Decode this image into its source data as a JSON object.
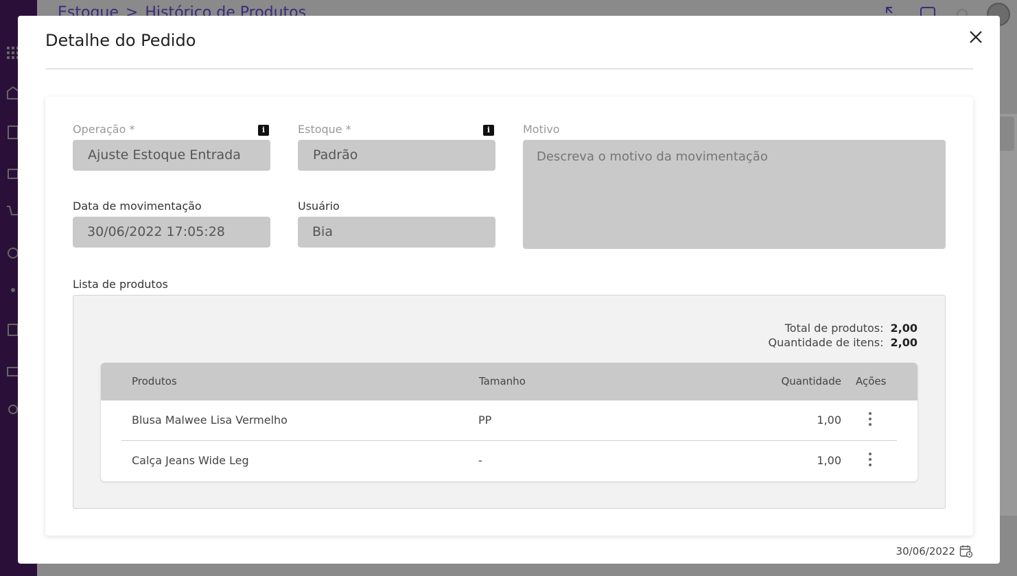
{
  "background": {
    "breadcrumb": [
      "Estoque",
      ">",
      "Histórico de Produtos"
    ]
  },
  "modal": {
    "title": "Detalhe do Pedido",
    "fields": {
      "operacao": {
        "label": "Operação *",
        "value": "Ajuste Estoque Entrada"
      },
      "estoque": {
        "label": "Estoque *",
        "value": "Padrão"
      },
      "motivo": {
        "label": "Motivo",
        "placeholder": "Descreva o motivo da movimentação"
      },
      "data": {
        "label": "Data de movimentação",
        "value": "30/06/2022 17:05:28"
      },
      "usuario": {
        "label": "Usuário",
        "value": "Bia"
      }
    },
    "list": {
      "label": "Lista de produtos",
      "totals": [
        {
          "label": "Total de produtos:",
          "value": "2,00"
        },
        {
          "label": "Quantidade de itens:",
          "value": "2,00"
        }
      ],
      "columns": [
        "Produtos",
        "Tamanho",
        "Quantidade",
        "Ações"
      ],
      "rows": [
        {
          "produto": "Blusa Malwee Lisa Vermelho",
          "tamanho": "PP",
          "quantidade": "1,00"
        },
        {
          "produto": "Calça Jeans Wide Leg",
          "tamanho": "-",
          "quantidade": "1,00"
        }
      ]
    },
    "footer_date": "30/06/2022"
  }
}
